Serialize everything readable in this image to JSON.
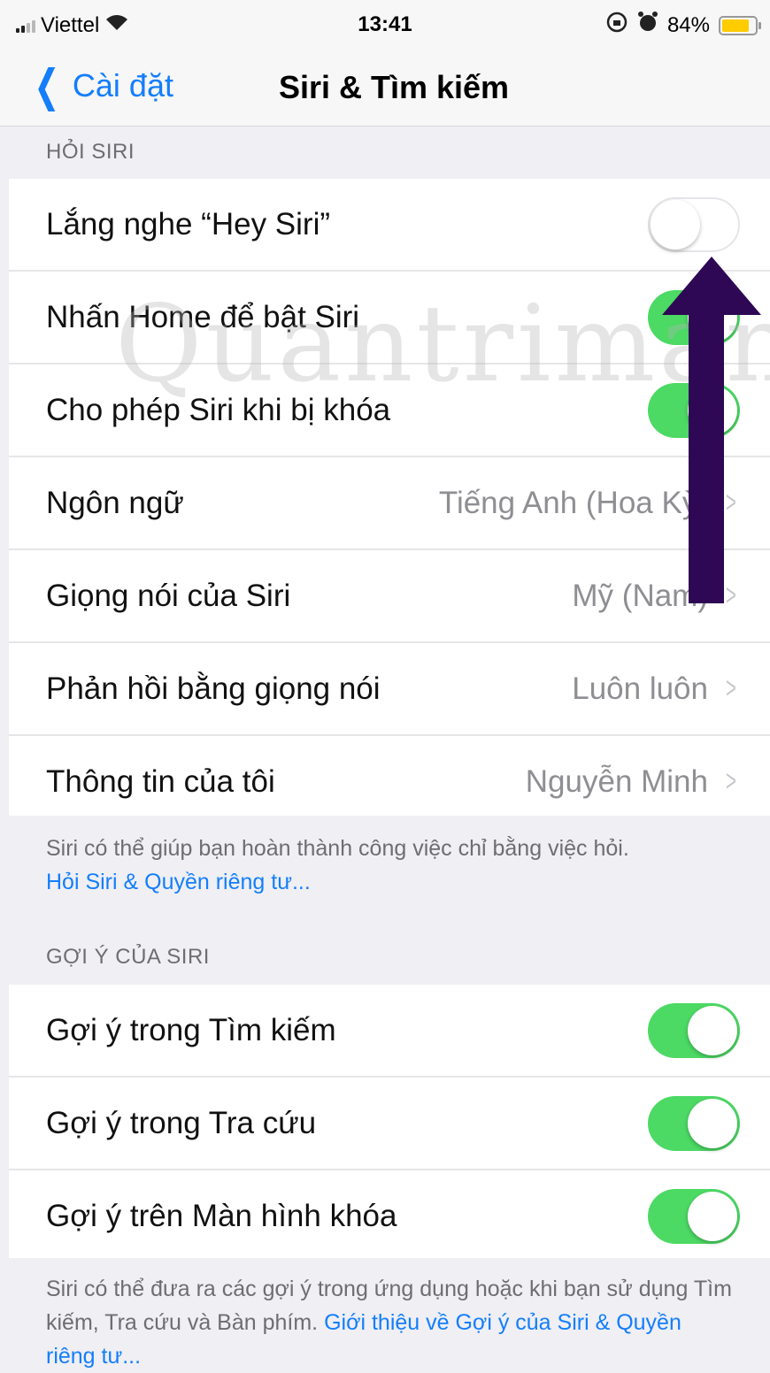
{
  "status_bar": {
    "carrier": "Viettel",
    "time": "13:41",
    "battery": "84%",
    "battery_level": 0.84
  },
  "nav": {
    "back_label": "Cài đặt",
    "title": "Siri & Tìm kiếm"
  },
  "ask_siri": {
    "header": "HỎI SIRI",
    "rows": [
      {
        "label": "Lắng nghe “Hey Siri”",
        "toggle": false
      },
      {
        "label": "Nhấn Home để bật Siri",
        "toggle": true
      },
      {
        "label": "Cho phép Siri khi bị khóa",
        "toggle": true
      },
      {
        "label": "Ngôn ngữ",
        "value": "Tiếng Anh (Hoa Kỳ)"
      },
      {
        "label": "Giọng nói của Siri",
        "value": "Mỹ (Nam)"
      },
      {
        "label": "Phản hồi bằng giọng nói",
        "value": "Luôn luôn"
      },
      {
        "label": "Thông tin của tôi",
        "value": "Nguyễn Minh"
      }
    ],
    "footer_text": "Siri có thể giúp bạn hoàn thành công việc chỉ bằng việc hỏi.",
    "footer_link": "Hỏi Siri & Quyền riêng tư..."
  },
  "suggestions": {
    "header": "GỢI Ý CỦA SIRI",
    "rows": [
      {
        "label": "Gợi ý trong Tìm kiếm",
        "toggle": true
      },
      {
        "label": "Gợi ý trong Tra cứu",
        "toggle": true
      },
      {
        "label": "Gợi ý trên Màn hình khóa",
        "toggle": true
      }
    ],
    "footer_text": "Siri có thể đưa ra các gợi ý trong ứng dụng hoặc khi bạn sử dụng Tìm kiếm, Tra cứu và Bàn phím. ",
    "footer_link": "Giới thiệu về Gợi ý của Siri & Quyền riêng tư..."
  },
  "watermark": "Quantrimang",
  "colors": {
    "accent": "#147efb",
    "toggle_on": "#4cd964",
    "arrow": "#2e0854",
    "background": "#efeff4"
  }
}
